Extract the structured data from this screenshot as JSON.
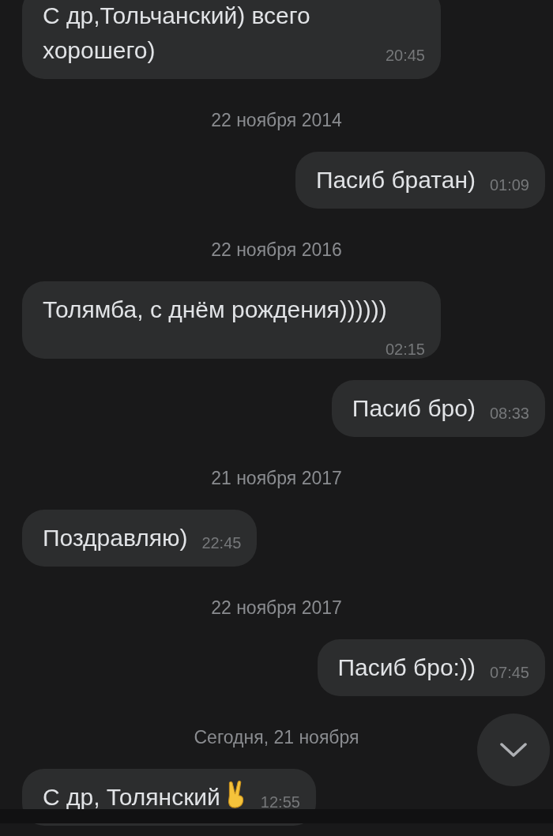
{
  "items": [
    {
      "kind": "message",
      "outgoing": false,
      "text": "С др,Тольчанский) всего хорошего)",
      "time": "20:45"
    },
    {
      "kind": "date",
      "text": "22 ноября 2014"
    },
    {
      "kind": "message",
      "outgoing": true,
      "text": "Пасиб братан)",
      "time": "01:09"
    },
    {
      "kind": "date",
      "text": "22 ноября 2016"
    },
    {
      "kind": "message",
      "outgoing": false,
      "text": "Толямба, с днём рождения))))))",
      "time": "02:15"
    },
    {
      "kind": "message",
      "outgoing": true,
      "text": "Пасиб бро)",
      "time": "08:33"
    },
    {
      "kind": "date",
      "text": "21 ноября 2017"
    },
    {
      "kind": "message",
      "outgoing": false,
      "text": "Поздравляю)",
      "time": "22:45"
    },
    {
      "kind": "date",
      "text": "22 ноября 2017"
    },
    {
      "kind": "message",
      "outgoing": true,
      "text": "Пасиб бро:))",
      "time": "07:45"
    },
    {
      "kind": "date",
      "text": "Сегодня, 21 ноября"
    },
    {
      "kind": "message",
      "outgoing": false,
      "text": "С др, Толянский",
      "trailing_icon": true,
      "time": "12:55"
    }
  ]
}
